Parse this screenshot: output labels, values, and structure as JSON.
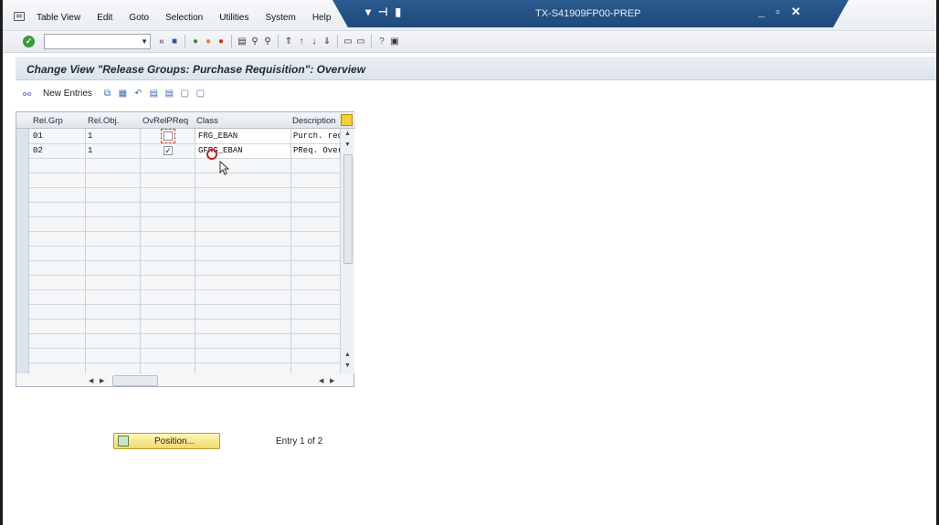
{
  "menu": {
    "items": [
      "Table View",
      "Edit",
      "Goto",
      "Selection",
      "Utilities",
      "System",
      "Help"
    ]
  },
  "titlebar": {
    "system_title": "TX-S41909FP00-PREP"
  },
  "toolbar": {
    "command_value": ""
  },
  "header": {
    "title": "Change View \"Release Groups: Purchase Requisition\": Overview"
  },
  "app_toolbar": {
    "new_entries_label": "New Entries"
  },
  "table": {
    "columns": [
      "Rel.Grp",
      "Rel.Obj.",
      "OvRelPReq",
      "Class",
      "Description"
    ],
    "rows": [
      {
        "rel_grp": "01",
        "rel_obj": "1",
        "ovrel": false,
        "class": "FRG_EBAN",
        "description": "Purch. req."
      },
      {
        "rel_grp": "02",
        "rel_obj": "1",
        "ovrel": true,
        "class": "GFRG_EBAN",
        "description": "PReq. Overa"
      }
    ]
  },
  "bottom": {
    "position_label": "Position...",
    "entry_text": "Entry 1 of 2"
  },
  "colors": {
    "title_strip": "#1f4a7d",
    "accent_yellow": "#f1d96c"
  }
}
